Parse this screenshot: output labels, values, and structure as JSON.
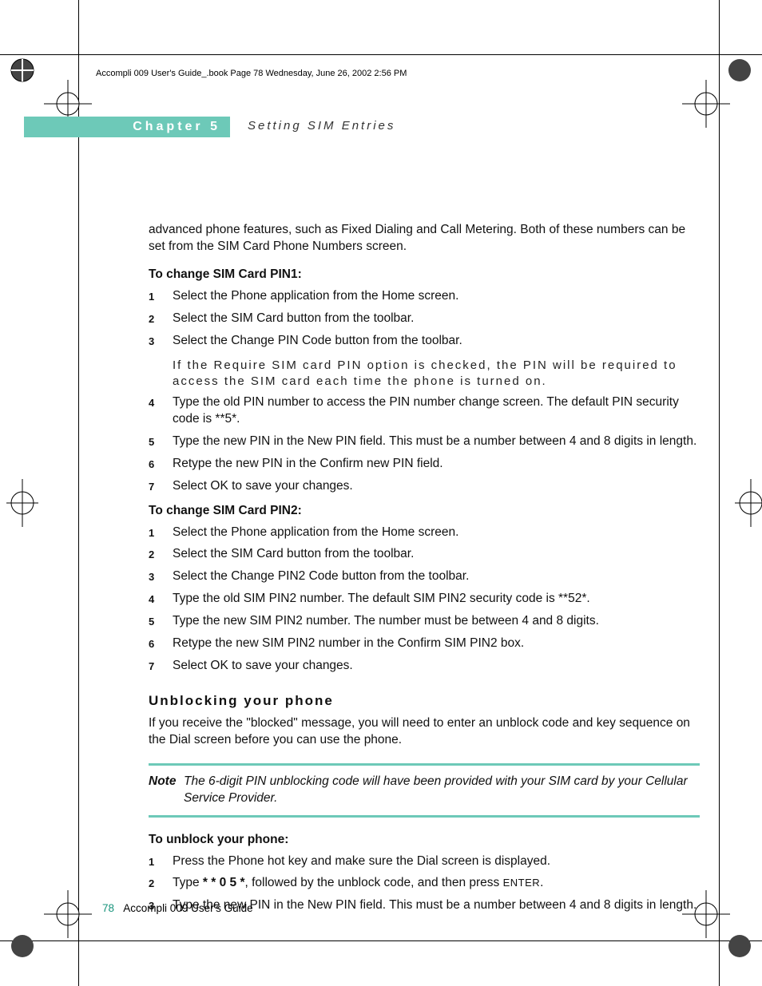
{
  "header_line": "Accompli 009 User's Guide_.book  Page 78  Wednesday, June 26, 2002  2:56 PM",
  "chapter_bar": "Chapter 5",
  "chapter_title": "Setting SIM Entries",
  "intro": "advanced phone features, such as Fixed Dialing and Call Metering. Both of these numbers can be set from the SIM Card Phone Numbers screen.",
  "pin1": {
    "heading": "To change SIM Card PIN1:",
    "steps": [
      "Select the Phone application from the Home screen.",
      "Select the SIM Card button from the toolbar.",
      "Select the Change PIN Code button from the toolbar.",
      "Type the old PIN number to access the PIN number change screen. The default PIN security code is **5*.",
      "Type the new PIN in the New PIN field.  This must be a number between 4 and 8 digits in length.",
      "Retype the new PIN in the Confirm new PIN field.",
      "Select OK to save your changes."
    ],
    "note_after_3": "If the Require SIM card PIN option is checked, the PIN will be required to access the SIM card each time the phone is turned on."
  },
  "pin2": {
    "heading": "To change SIM Card PIN2:",
    "steps": [
      "Select the Phone application from the Home screen.",
      "Select the SIM Card button from the toolbar.",
      "Select the Change PIN2 Code button from the toolbar.",
      "Type the old SIM PIN2 number. The default SIM PIN2 security code is **52*.",
      "Type the new SIM PIN2 number.  The number must be between 4 and 8 digits.",
      "Retype the new SIM PIN2 number in the Confirm SIM PIN2 box.",
      "Select OK to save your changes."
    ]
  },
  "unblock": {
    "section_head": "Unblocking your phone",
    "intro": "If you receive the \"blocked\" message, you will need to enter an unblock code and key sequence on the Dial screen before you can use the phone.",
    "note_label": "Note",
    "note_body": "The 6-digit PIN unblocking code will have been provided with your SIM card by your Cellular Service Provider.",
    "heading": "To unblock your phone:",
    "step1": "Press the Phone hot key and make sure the Dial screen is displayed.",
    "step2_pre": "Type ",
    "step2_bold": "* * 0 5 *",
    "step2_mid": ", followed by the unblock code, and then press ",
    "step2_enter": "ENTER",
    "step2_post": ".",
    "step3": "Type the new PIN in the New PIN field.  This must be a number between 4 and 8 digits in length."
  },
  "footer": {
    "page_num": "78",
    "title": "Accompli 009 User's Guide"
  }
}
